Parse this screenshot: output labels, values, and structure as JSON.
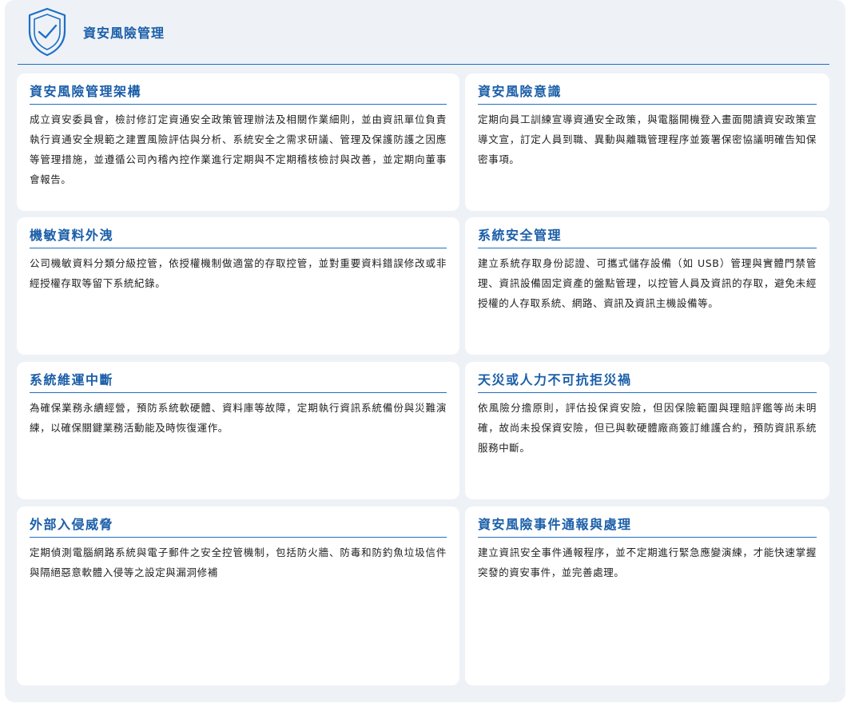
{
  "header": {
    "title": "資安風險管理",
    "icon": "shield-check-icon",
    "accent_color": "#1a5ea8"
  },
  "cards": [
    {
      "title": "資安風險管理架構",
      "body": "成立資安委員會，檢討修訂定資通安全政策管理辦法及相關作業細則，並由資訊單位負責執行資通安全規範之建置風險評估與分析、系統安全之需求研議、管理及保護防護之因應等管理措施，並遵循公司內稽內控作業進行定期與不定期稽核檢討與改善，並定期向董事會報告。"
    },
    {
      "title": "資安風險意識",
      "body": "定期向員工訓練宣導資通安全政策，與電腦開機登入畫面閱讀資安政策宣導文宣，訂定人員到職、異動與離職管理程序並簽署保密協議明確告知保密事項。"
    },
    {
      "title": "機敏資料外洩",
      "body": "公司機敏資料分類分級控管，依授權機制做適當的存取控管，並對重要資料錯誤修改或非經授權存取等留下系統紀錄。"
    },
    {
      "title": "系統安全管理",
      "body": "建立系統存取身份認證、可攜式儲存設備（如 USB）管理與實體門禁管理、資訊設備固定資產的盤點管理，以控管人員及資訊的存取，避免未經授權的人存取系統、網路、資訊及資訊主機設備等。"
    },
    {
      "title": "系統維運中斷",
      "body": "為確保業務永續經營，預防系統軟硬體、資料庫等故障，定期執行資訊系統備份與災難演練，以確保關鍵業務活動能及時恢復運作。"
    },
    {
      "title": "天災或人力不可抗拒災禍",
      "body": "依風險分擔原則，評估投保資安險，但因保險範圍與理賠評鑑等尚未明確，故尚未投保資安險，但已與軟硬體廠商簽訂維護合約，預防資訊系統服務中斷。"
    },
    {
      "title": "外部入侵威脅",
      "body": "定期偵測電腦網路系統與電子郵件之安全控管機制，包括防火牆、防毒和防釣魚垃圾信件與隔絕惡意軟體入侵等之設定與漏洞修補"
    },
    {
      "title": "資安風險事件通報與處理",
      "body": "建立資訊安全事件通報程序，並不定期進行緊急應變演練，才能快速掌握突發的資安事件，並完善處理。"
    }
  ]
}
